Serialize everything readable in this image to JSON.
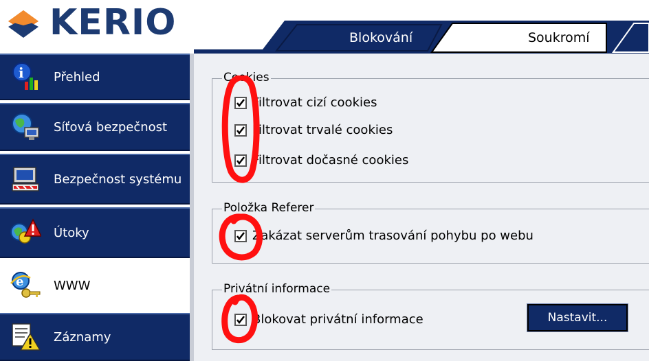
{
  "brand": {
    "logo_text": "KERIO"
  },
  "tabs": [
    {
      "label": "Blokování",
      "selected": false
    },
    {
      "label": "Soukromí",
      "selected": true
    }
  ],
  "sidebar": {
    "items": [
      {
        "label": "Přehled",
        "icon": "chart-info-icon",
        "active": false
      },
      {
        "label": "Síťová bezpečnost",
        "icon": "network-globe-icon",
        "active": false
      },
      {
        "label": "Bezpečnost systému",
        "icon": "computer-shield-icon",
        "active": false
      },
      {
        "label": "Útoky",
        "icon": "attack-warning-icon",
        "active": false
      },
      {
        "label": "WWW",
        "icon": "ie-globe-key-icon",
        "active": true
      },
      {
        "label": "Záznamy",
        "icon": "log-warning-icon",
        "active": false
      }
    ]
  },
  "groups": {
    "cookies": {
      "title": "Cookies",
      "options": [
        {
          "label": "Filtrovat cizí cookies",
          "checked": true
        },
        {
          "label": "Filtrovat trvalé cookies",
          "checked": true
        },
        {
          "label": "Filtrovat dočasné cookies",
          "checked": true
        }
      ]
    },
    "referer": {
      "title": "Položka Referer",
      "options": [
        {
          "label": "Zakázat serverům trasování pohybu po webu",
          "checked": true
        }
      ]
    },
    "private": {
      "title": "Privátní informace",
      "options": [
        {
          "label": "Blokovat privátní informace",
          "checked": true
        }
      ],
      "button_label": "Nastavit..."
    }
  },
  "colors": {
    "navy": "#102a66",
    "brand_blue": "#1d3b72",
    "panel": "#eef0f4",
    "annotation_red": "#ff1010",
    "logo_orange": "#f07a1a"
  }
}
